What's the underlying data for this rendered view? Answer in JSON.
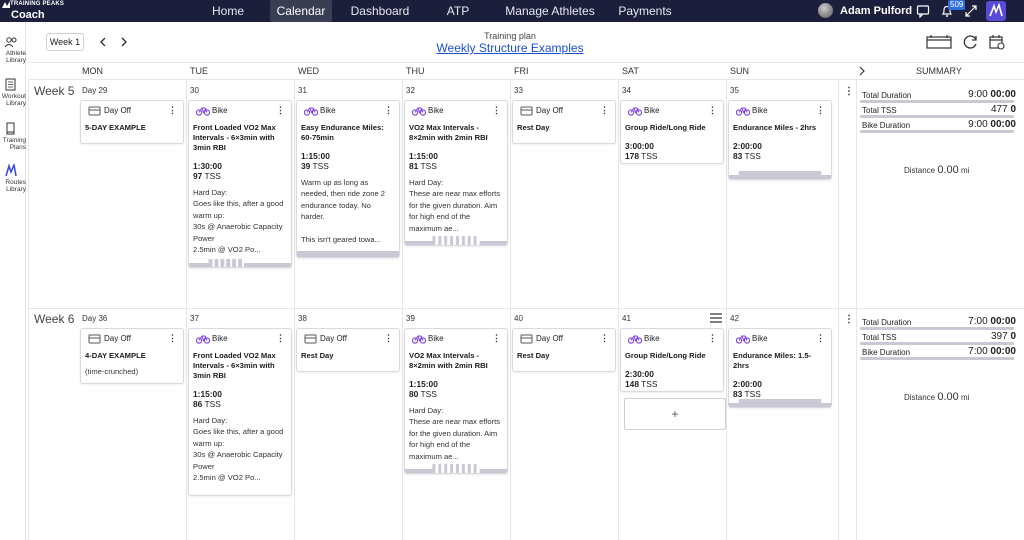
{
  "brand": {
    "top": "TRAINING PEAKS",
    "name": "Coach"
  },
  "nav": {
    "items": [
      "Home",
      "Calendar",
      "Dashboard",
      "ATP",
      "Manage Athletes",
      "Payments"
    ],
    "active": "Calendar"
  },
  "user": {
    "name": "Adam Pulford",
    "notifications": "509"
  },
  "sidebar": {
    "items": [
      "Athlete\nLibrary",
      "Workout\nLibrary",
      "Training\nPlans",
      "Routes\nLibrary"
    ]
  },
  "toolbar": {
    "week_button": "Week 1",
    "plan_label": "Training plan",
    "plan_title": "Weekly Structure Examples"
  },
  "days": [
    "MON",
    "TUE",
    "WED",
    "THU",
    "FRI",
    "SAT",
    "SUN"
  ],
  "summary_header": "SUMMARY",
  "weeks": [
    {
      "label": "Week 5",
      "day_numbers": [
        "Day 29",
        "30",
        "31",
        "32",
        "33",
        "34",
        "35"
      ],
      "cards": [
        {
          "type": "Day Off",
          "icon": "day-off-icon",
          "title": "5-DAY EXAMPLE",
          "sub": "",
          "duration": "",
          "tss": "",
          "desc": ""
        },
        {
          "type": "Bike",
          "icon": "bike-icon",
          "title": "Front Loaded VO2 Max Intervals - 6×3min with 3min RBI",
          "duration": "1:30:00",
          "tss": "97",
          "desc": "Hard Day:\nGoes like this, after a good warm up:\n30s @ Anaerobic Capacity Power\n2.5min @ VO2 Po..."
        },
        {
          "type": "Bike",
          "icon": "bike-icon",
          "title": "Easy Endurance Miles: 60-75min",
          "duration": "1:15:00",
          "tss": "39",
          "desc": "Warm up as long as needed, then ride zone 2 endurance today. No harder.\n\nThis isn't geared towa..."
        },
        {
          "type": "Bike",
          "icon": "bike-icon",
          "title": "VO2 Max Intervals - 8×2min with 2min RBI",
          "duration": "1:15:00",
          "tss": "81",
          "desc": "Hard Day:\nThese are near max efforts for the given duration. Aim for high end of the maximum ae..."
        },
        {
          "type": "Day Off",
          "icon": "day-off-icon",
          "title": "Rest Day",
          "duration": "",
          "tss": "",
          "desc": ""
        },
        {
          "type": "Bike",
          "icon": "bike-icon",
          "title": "Group Ride/Long Ride",
          "duration": "3:00:00",
          "tss": "178",
          "desc": ""
        },
        {
          "type": "Bike",
          "icon": "bike-icon",
          "title": "Endurance Miles - 2hrs",
          "duration": "2:00:00",
          "tss": "83",
          "desc": ""
        }
      ],
      "summary": {
        "total_duration_label": "Total Duration",
        "total_duration_planned": "9:00",
        "total_duration_completed": "00:00",
        "total_duration_fill": 1.0,
        "total_tss_label": "Total TSS",
        "total_tss_planned": "477",
        "total_tss_completed": "0",
        "total_tss_fill": 1.0,
        "bike_duration_label": "Bike Duration",
        "bike_duration_planned": "9:00",
        "bike_duration_completed": "00:00",
        "bike_duration_fill": 1.0,
        "distance_label": "Distance",
        "distance_value": "0.00",
        "distance_unit": "mi"
      }
    },
    {
      "label": "Week 6",
      "day_numbers": [
        "Day 36",
        "37",
        "38",
        "39",
        "40",
        "41",
        "42"
      ],
      "cards": [
        {
          "type": "Day Off",
          "icon": "day-off-icon",
          "title": "4-DAY EXAMPLE",
          "sub": "(time-crunched)",
          "duration": "",
          "tss": "",
          "desc": ""
        },
        {
          "type": "Bike",
          "icon": "bike-icon",
          "title": "Front Loaded VO2 Max Intervals - 6×3min with 3min RBI",
          "duration": "1:15:00",
          "tss": "86",
          "desc": "Hard Day:\nGoes like this, after a good warm up:\n30s @ Anaerobic Capacity Power\n2.5min @ VO2 Po..."
        },
        {
          "type": "Day Off",
          "icon": "day-off-icon",
          "title": "Rest Day",
          "duration": "",
          "tss": "",
          "desc": ""
        },
        {
          "type": "Bike",
          "icon": "bike-icon",
          "title": "VO2 Max Intervals - 8×2min with 2min RBI",
          "duration": "1:15:00",
          "tss": "80",
          "desc": "Hard Day:\nThese are near max efforts for the given duration. Aim for high end of the maximum ae..."
        },
        {
          "type": "Day Off",
          "icon": "day-off-icon",
          "title": "Rest Day",
          "duration": "",
          "tss": "",
          "desc": ""
        },
        {
          "type": "Bike",
          "icon": "bike-icon",
          "title": "Group Ride/Long Ride",
          "duration": "2:30:00",
          "tss": "148",
          "desc": ""
        },
        {
          "type": "Bike",
          "icon": "bike-icon",
          "title": "Endurance Miles: 1.5-2hrs",
          "duration": "2:00:00",
          "tss": "83",
          "desc": ""
        }
      ],
      "summary": {
        "total_duration_label": "Total Duration",
        "total_duration_planned": "7:00",
        "total_duration_completed": "00:00",
        "total_duration_fill": 1.0,
        "total_tss_label": "Total TSS",
        "total_tss_planned": "397",
        "total_tss_completed": "0",
        "total_tss_fill": 1.0,
        "bike_duration_label": "Bike Duration",
        "bike_duration_planned": "7:00",
        "bike_duration_completed": "00:00",
        "bike_duration_fill": 1.0,
        "distance_label": "Distance",
        "distance_value": "0.00",
        "distance_unit": "mi"
      }
    }
  ],
  "add_workout_symbol": "+",
  "tss_unit": "TSS",
  "colors": {
    "nav_bg": "#1b1f3b",
    "link": "#1a4fd0",
    "bike": "#7b3fe4",
    "bar": "#c9c9d6"
  }
}
